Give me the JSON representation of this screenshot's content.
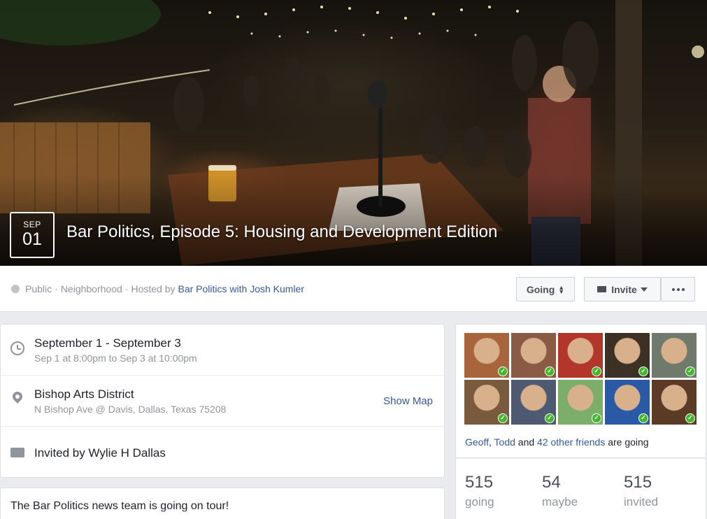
{
  "event": {
    "month": "SEP",
    "day": "01",
    "title": "Bar Politics, Episode 5: Housing and Development Edition"
  },
  "meta": {
    "privacy": "Public",
    "sep1": "·",
    "category": "Neighborhood",
    "sep2": "·",
    "hosted_by_label": "Hosted by",
    "host": "Bar Politics with Josh Kumler"
  },
  "actions": {
    "going_label": "Going",
    "invite_label": "Invite"
  },
  "details": {
    "date_primary": "September 1 - September 3",
    "date_secondary": "Sep 1 at 8:00pm to Sep 3 at 10:00pm",
    "location_primary": "Bishop Arts District",
    "location_secondary": "N Bishop Ave @ Davis, Dallas, Texas 75208",
    "show_map": "Show Map",
    "invited_by": "Invited by Wylie H Dallas"
  },
  "description": {
    "first_line": "The Bar Politics news team is going on tour!"
  },
  "friends": {
    "name1": "Geoff",
    "comma": ",",
    "name2": "Todd",
    "and": "and",
    "others": "42 other friends",
    "suffix": "are going",
    "avatars": [
      {
        "name": "friend-1",
        "color": "#a8643a"
      },
      {
        "name": "friend-2",
        "color": "#8a5a44"
      },
      {
        "name": "friend-3",
        "color": "#b3362b"
      },
      {
        "name": "friend-4",
        "color": "#3d3024"
      },
      {
        "name": "friend-5",
        "color": "#6f7a6d"
      },
      {
        "name": "friend-6",
        "color": "#7a5a3c"
      },
      {
        "name": "friend-7",
        "color": "#4d5a72"
      },
      {
        "name": "friend-8",
        "color": "#7cae6a"
      },
      {
        "name": "friend-9",
        "color": "#2a5aa6"
      },
      {
        "name": "friend-10",
        "color": "#5b3a26"
      }
    ]
  },
  "stats": {
    "going_count": "515",
    "going_label": "going",
    "maybe_count": "54",
    "maybe_label": "maybe",
    "invited_count": "515",
    "invited_label": "invited"
  }
}
